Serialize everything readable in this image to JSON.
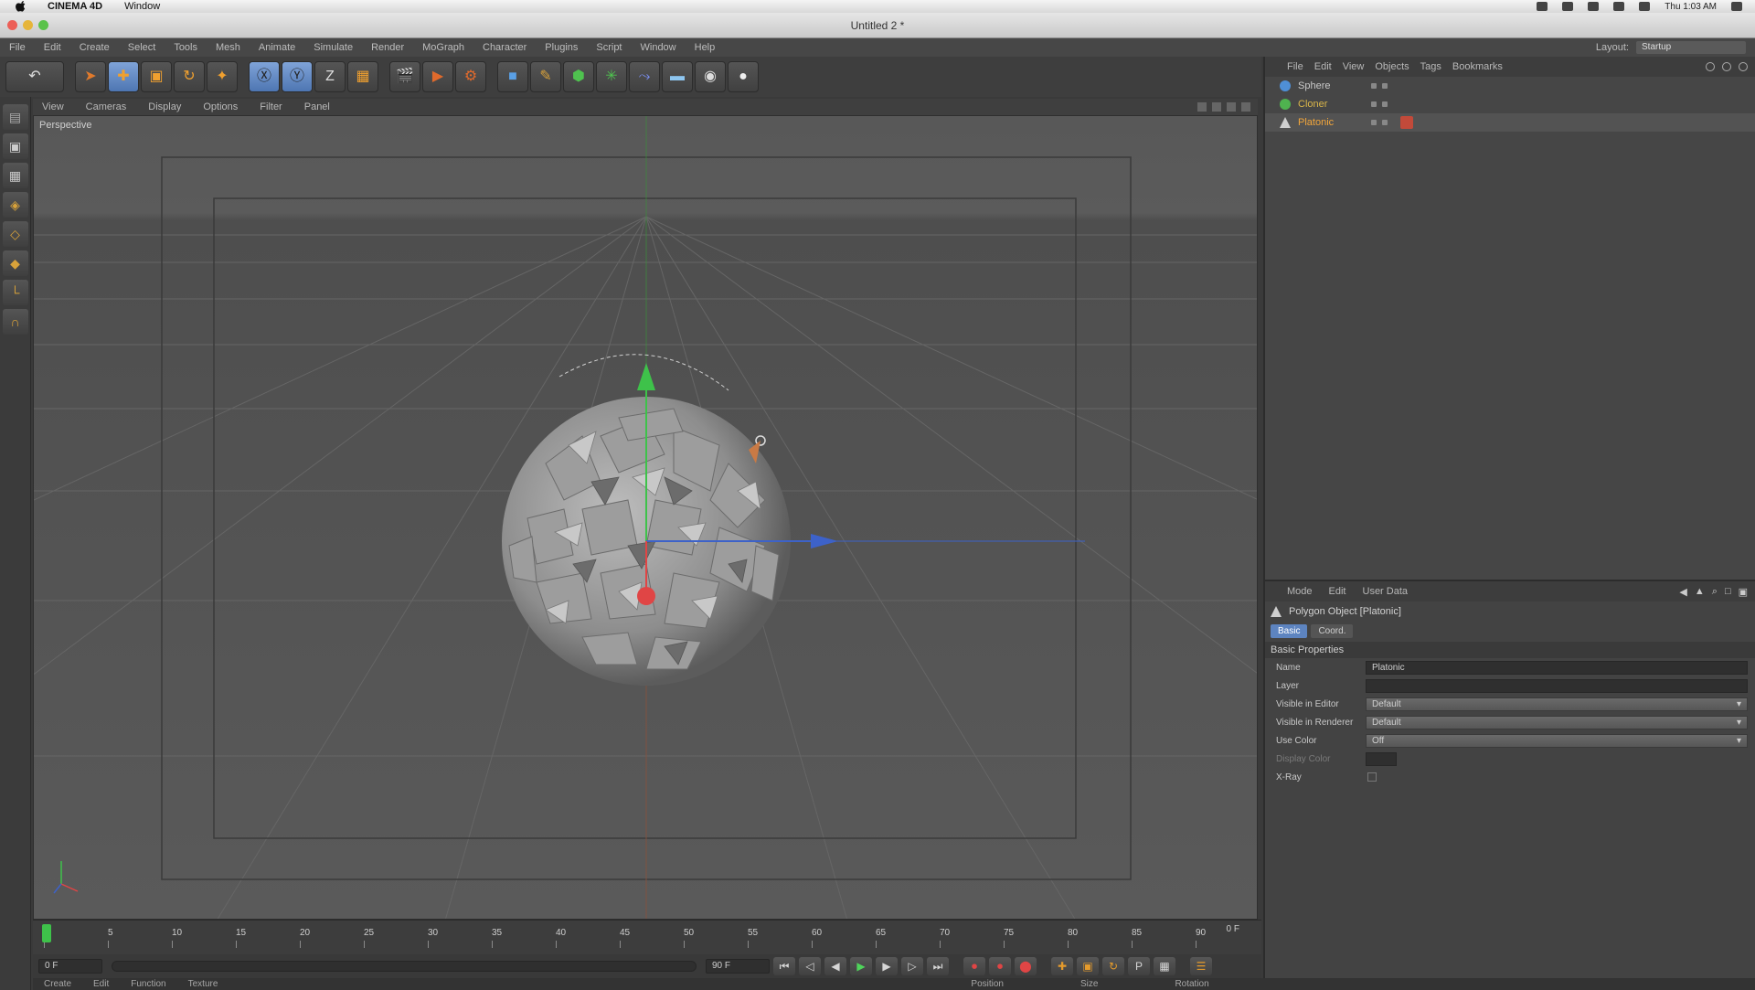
{
  "os_menubar": {
    "app_name": "CINEMA 4D",
    "menu": "Window",
    "clock": "Thu 1:03 AM"
  },
  "window": {
    "title": "Untitled 2 *"
  },
  "app_menu": {
    "items": [
      "File",
      "Edit",
      "Create",
      "Select",
      "Tools",
      "Mesh",
      "Animate",
      "Simulate",
      "Render",
      "MoGraph",
      "Character",
      "Plugins",
      "Script",
      "Window",
      "Help"
    ],
    "layout_label": "Layout:",
    "layout_value": "Startup"
  },
  "viewport": {
    "menu": [
      "View",
      "Cameras",
      "Display",
      "Options",
      "Filter",
      "Panel"
    ],
    "camera_label": "Perspective"
  },
  "timeline": {
    "ticks": [
      "0",
      "5",
      "10",
      "15",
      "20",
      "25",
      "30",
      "35",
      "40",
      "45",
      "50",
      "55",
      "60",
      "65",
      "70",
      "75",
      "80",
      "85",
      "90"
    ],
    "end_label": "0 F",
    "current_frame": 0
  },
  "transport": {
    "start_field": "0 F",
    "end_field": "90 F"
  },
  "bottom_tabs": {
    "left": [
      "Create",
      "Edit",
      "Function",
      "Texture"
    ],
    "right": [
      "Position",
      "Size",
      "Rotation"
    ]
  },
  "object_manager": {
    "menu": [
      "File",
      "Edit",
      "View",
      "Objects",
      "Tags",
      "Bookmarks"
    ],
    "objects": [
      {
        "name": "Sphere",
        "color": "#4f8fd6",
        "name_color": "#c9c9c9"
      },
      {
        "name": "Cloner",
        "color": "#4fb24f",
        "name_color": "#d9b54a"
      },
      {
        "name": "Platonic",
        "color": "#cfcfcf",
        "name_color": "#f2a63b"
      }
    ]
  },
  "attribute_manager": {
    "menu": [
      "Mode",
      "Edit",
      "User Data"
    ],
    "object_title": "Polygon Object [Platonic]",
    "tabs": [
      "Basic",
      "Coord."
    ],
    "active_tab": "Basic",
    "section": "Basic Properties",
    "fields": {
      "name_label": "Name",
      "name_value": "Platonic",
      "layer_label": "Layer",
      "layer_value": "",
      "vis_editor_label": "Visible in Editor",
      "vis_editor_value": "Default",
      "vis_render_label": "Visible in Renderer",
      "vis_render_value": "Default",
      "use_color_label": "Use Color",
      "use_color_value": "Off",
      "display_color_label": "Display Color",
      "xray_label": "X-Ray"
    }
  },
  "colors": {
    "accent_blue": "#5d84c0",
    "axis_green": "#3ec24a",
    "axis_red": "#e04545",
    "axis_blue": "#3d62c9"
  }
}
